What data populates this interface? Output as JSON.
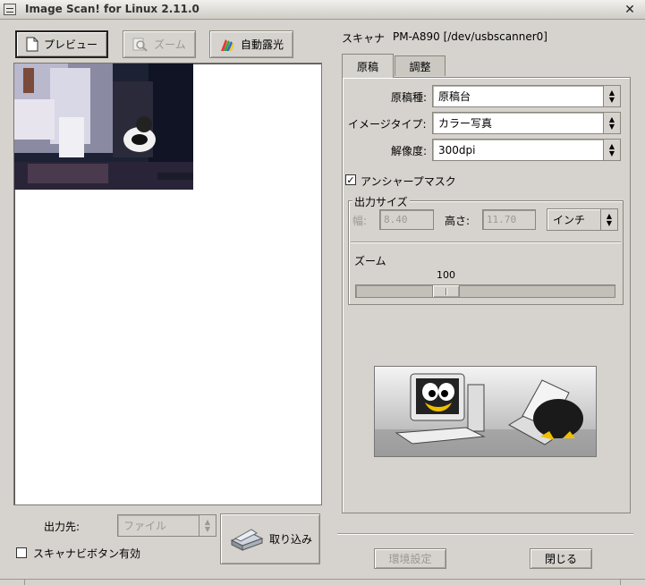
{
  "window": {
    "title": "Image Scan! for Linux 2.11.0",
    "close_glyph": "✕"
  },
  "toolbar": {
    "preview_label": "プレビュー",
    "zoom_label": "ズーム",
    "auto_exposure_label": "自動露光"
  },
  "output": {
    "label": "出力先:",
    "destination": "ファイル",
    "scanner_button_checkbox_label": "スキャナビボタン有効",
    "scanner_button_enabled": false,
    "scan_label": "取り込み"
  },
  "scanner": {
    "label": "スキャナ",
    "device": "PM-A890 [/dev/usbscanner0]"
  },
  "tabs": [
    {
      "label": "原稿",
      "active": true
    },
    {
      "label": "調整",
      "active": false
    }
  ],
  "document": {
    "source_label": "原稿種:",
    "source_value": "原稿台",
    "image_type_label": "イメージタイプ:",
    "image_type_value": "カラー写真",
    "resolution_label": "解像度:",
    "resolution_value": "300dpi",
    "unsharp_label": "アンシャープマスク",
    "unsharp_checked": true
  },
  "output_size": {
    "group_label": "出力サイズ",
    "width_label": "幅:",
    "width_value": "8.40",
    "height_label": "高さ:",
    "height_value": "11.70",
    "unit_value": "インチ",
    "zoom_label": "ズーム",
    "zoom_value": "100"
  },
  "footer": {
    "settings_label": "環境設定",
    "close_label": "閉じる"
  },
  "icons": {
    "preview": "document-icon",
    "zoom": "magnifier-icon",
    "auto_exposure": "color-palette-icon",
    "scan": "scanner-icon",
    "spin_up": "▲",
    "spin_down": "▼",
    "check": "✓"
  },
  "colors": {
    "window_bg": "#d6d3ce",
    "preview_bg": "#ffffff",
    "disabled_text": "#9b9891"
  }
}
